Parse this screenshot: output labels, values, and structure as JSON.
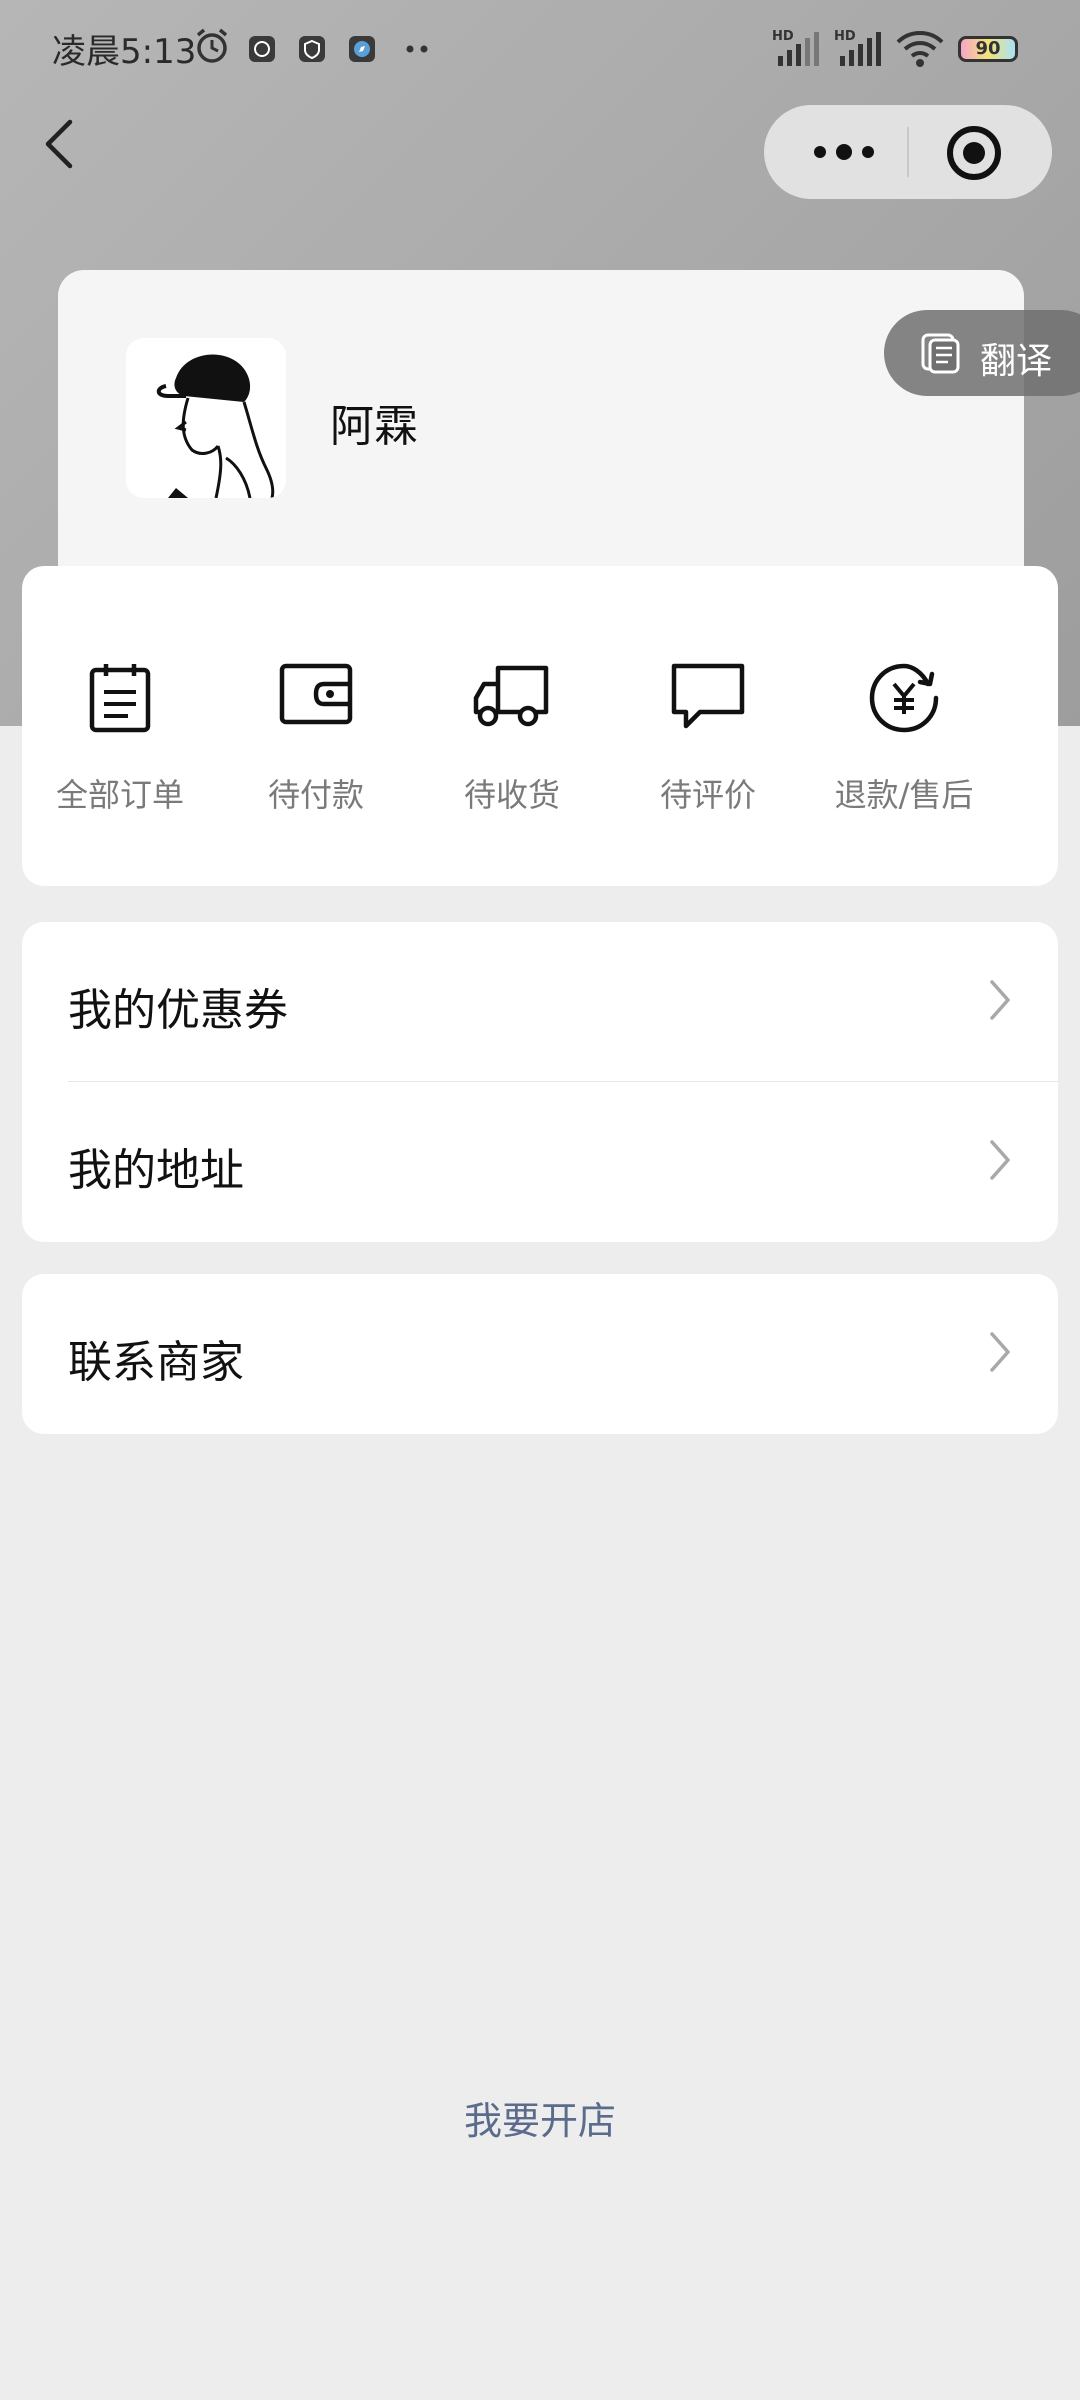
{
  "status_bar": {
    "time": "凌晨5:13",
    "icons": [
      "alarm-icon",
      "app-notification-icon",
      "shield-icon",
      "compass-icon",
      "more-dots-icon",
      "hd-signal-icon",
      "hd-signal-icon",
      "wifi-icon",
      "battery-icon"
    ],
    "network_1": "HD",
    "network_2": "HD",
    "battery": "90"
  },
  "nav": {
    "back_icon": "chevron-left-icon",
    "more_icon": "more-dots-icon",
    "close_icon": "target-circle-icon"
  },
  "profile": {
    "name": "阿霖",
    "avatar_icon": "line-drawing-avatar"
  },
  "translate": {
    "label": "翻译",
    "icon": "translate-icon"
  },
  "orders": [
    {
      "label": "全部订单",
      "icon": "clipboard-icon"
    },
    {
      "label": "待付款",
      "icon": "wallet-icon"
    },
    {
      "label": "待收货",
      "icon": "truck-icon"
    },
    {
      "label": "待评价",
      "icon": "chat-bubble-icon"
    },
    {
      "label": "退款/售后",
      "icon": "yen-refund-icon"
    }
  ],
  "menu": {
    "group1": [
      {
        "label": "我的优惠券"
      },
      {
        "label": "我的地址"
      }
    ],
    "group2": [
      {
        "label": "联系商家"
      }
    ]
  },
  "footer": {
    "open_shop": "我要开店"
  },
  "colors": {
    "header_bg": "#a9a9a9",
    "page_bg": "#ededed",
    "card_bg": "#ffffff",
    "link": "#5b6b8c",
    "label_grey": "#7a7a7a"
  }
}
